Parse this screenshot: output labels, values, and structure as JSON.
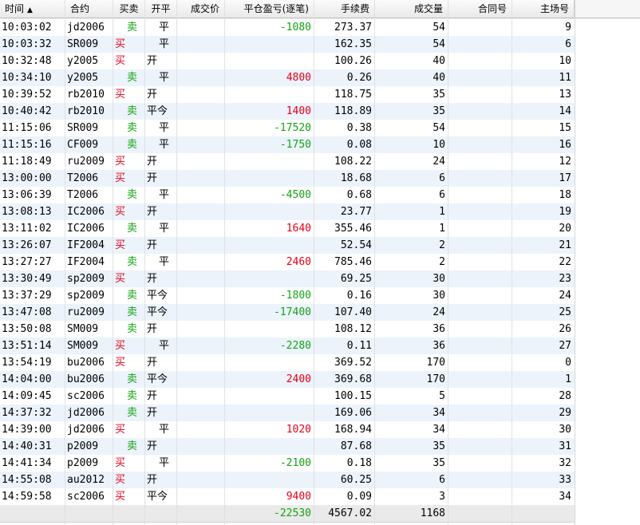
{
  "header": {
    "cols": [
      "时间",
      "合约",
      "买卖",
      "开平",
      "成交价",
      "平仓盈亏(逐笔)",
      "手续费",
      "成交量",
      "合同号",
      "主场号"
    ],
    "sort_arrow": "▲"
  },
  "rows": [
    {
      "time": "10:03:02",
      "contract": "jd2006",
      "side": "卖",
      "oc": "平",
      "pnl": "-1080",
      "fee": "273.37",
      "vol": "54",
      "id": "9"
    },
    {
      "time": "10:03:32",
      "contract": "SR009",
      "side": "买",
      "oc": "平",
      "pnl": "",
      "fee": "162.35",
      "vol": "54",
      "id": "6"
    },
    {
      "time": "10:32:48",
      "contract": "y2005",
      "side": "买",
      "oc": "开",
      "pnl": "",
      "fee": "100.26",
      "vol": "40",
      "id": "10"
    },
    {
      "time": "10:34:10",
      "contract": "y2005",
      "side": "卖",
      "oc": "平",
      "pnl": "4800",
      "fee": "0.26",
      "vol": "40",
      "id": "11"
    },
    {
      "time": "10:39:52",
      "contract": "rb2010",
      "side": "买",
      "oc": "开",
      "pnl": "",
      "fee": "118.75",
      "vol": "35",
      "id": "13"
    },
    {
      "time": "10:40:42",
      "contract": "rb2010",
      "side": "卖",
      "oc": "平今",
      "pnl": "1400",
      "fee": "118.89",
      "vol": "35",
      "id": "14"
    },
    {
      "time": "11:15:06",
      "contract": "SR009",
      "side": "卖",
      "oc": "平",
      "pnl": "-17520",
      "fee": "0.38",
      "vol": "54",
      "id": "15"
    },
    {
      "time": "11:15:16",
      "contract": "CF009",
      "side": "卖",
      "oc": "平",
      "pnl": "-1750",
      "fee": "0.08",
      "vol": "10",
      "id": "16"
    },
    {
      "time": "11:18:49",
      "contract": "ru2009",
      "side": "买",
      "oc": "开",
      "pnl": "",
      "fee": "108.22",
      "vol": "24",
      "id": "12"
    },
    {
      "time": "13:00:00",
      "contract": "T2006",
      "side": "买",
      "oc": "开",
      "pnl": "",
      "fee": "18.68",
      "vol": "6",
      "id": "17"
    },
    {
      "time": "13:06:39",
      "contract": "T2006",
      "side": "卖",
      "oc": "平",
      "pnl": "-4500",
      "fee": "0.68",
      "vol": "6",
      "id": "18"
    },
    {
      "time": "13:08:13",
      "contract": "IC2006",
      "side": "买",
      "oc": "开",
      "pnl": "",
      "fee": "23.77",
      "vol": "1",
      "id": "19"
    },
    {
      "time": "13:11:02",
      "contract": "IC2006",
      "side": "卖",
      "oc": "平",
      "pnl": "1640",
      "fee": "355.46",
      "vol": "1",
      "id": "20"
    },
    {
      "time": "13:26:07",
      "contract": "IF2004",
      "side": "买",
      "oc": "开",
      "pnl": "",
      "fee": "52.54",
      "vol": "2",
      "id": "21"
    },
    {
      "time": "13:27:27",
      "contract": "IF2004",
      "side": "卖",
      "oc": "平",
      "pnl": "2460",
      "fee": "785.46",
      "vol": "2",
      "id": "22"
    },
    {
      "time": "13:30:49",
      "contract": "sp2009",
      "side": "买",
      "oc": "开",
      "pnl": "",
      "fee": "69.25",
      "vol": "30",
      "id": "23"
    },
    {
      "time": "13:37:29",
      "contract": "sp2009",
      "side": "卖",
      "oc": "平今",
      "pnl": "-1800",
      "fee": "0.16",
      "vol": "30",
      "id": "24"
    },
    {
      "time": "13:47:08",
      "contract": "ru2009",
      "side": "卖",
      "oc": "平今",
      "pnl": "-17400",
      "fee": "107.40",
      "vol": "24",
      "id": "25"
    },
    {
      "time": "13:50:08",
      "contract": "SM009",
      "side": "卖",
      "oc": "开",
      "pnl": "",
      "fee": "108.12",
      "vol": "36",
      "id": "26"
    },
    {
      "time": "13:51:14",
      "contract": "SM009",
      "side": "买",
      "oc": "平",
      "pnl": "-2280",
      "fee": "0.11",
      "vol": "36",
      "id": "27"
    },
    {
      "time": "13:54:19",
      "contract": "bu2006",
      "side": "买",
      "oc": "开",
      "pnl": "",
      "fee": "369.52",
      "vol": "170",
      "id": "0"
    },
    {
      "time": "14:04:00",
      "contract": "bu2006",
      "side": "卖",
      "oc": "平今",
      "pnl": "2400",
      "fee": "369.68",
      "vol": "170",
      "id": "1"
    },
    {
      "time": "14:09:45",
      "contract": "sc2006",
      "side": "卖",
      "oc": "开",
      "pnl": "",
      "fee": "100.15",
      "vol": "5",
      "id": "28"
    },
    {
      "time": "14:37:32",
      "contract": "jd2006",
      "side": "卖",
      "oc": "开",
      "pnl": "",
      "fee": "169.06",
      "vol": "34",
      "id": "29"
    },
    {
      "time": "14:39:00",
      "contract": "jd2006",
      "side": "买",
      "oc": "平",
      "pnl": "1020",
      "fee": "168.94",
      "vol": "34",
      "id": "30"
    },
    {
      "time": "14:40:31",
      "contract": "p2009",
      "side": "卖",
      "oc": "开",
      "pnl": "",
      "fee": "87.68",
      "vol": "35",
      "id": "31"
    },
    {
      "time": "14:41:34",
      "contract": "p2009",
      "side": "买",
      "oc": "平",
      "pnl": "-2100",
      "fee": "0.18",
      "vol": "35",
      "id": "32"
    },
    {
      "time": "14:55:08",
      "contract": "au2012",
      "side": "买",
      "oc": "开",
      "pnl": "",
      "fee": "60.25",
      "vol": "6",
      "id": "33"
    },
    {
      "time": "14:59:58",
      "contract": "sc2006",
      "side": "买",
      "oc": "平今",
      "pnl": "9400",
      "fee": "0.09",
      "vol": "3",
      "id": "34"
    }
  ],
  "totals": {
    "pnl": "-22530",
    "fee": "4567.02",
    "vol": "1168"
  },
  "colors": {
    "buy": "#e8001a",
    "sell": "#13a313",
    "row_alt": "#ecf3fb"
  }
}
